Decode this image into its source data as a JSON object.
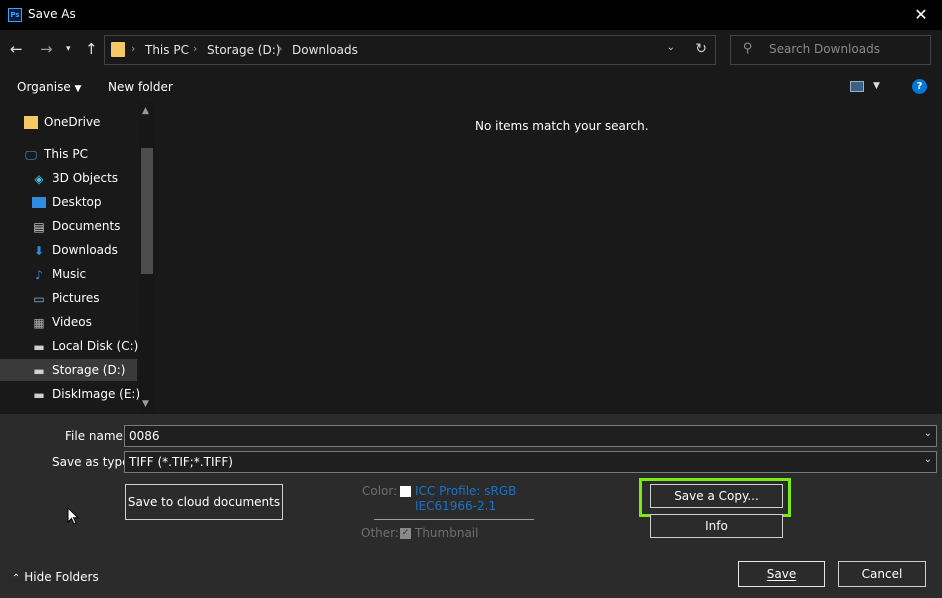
{
  "window": {
    "title": "Save As",
    "app_icon_text": "Ps"
  },
  "address": {
    "crumbs": [
      "This PC",
      "Storage (D:)",
      "Downloads"
    ]
  },
  "search": {
    "placeholder": "Search Downloads"
  },
  "toolbar": {
    "organise": "Organise",
    "new_folder": "New folder"
  },
  "sidebar": {
    "items": [
      {
        "label": "OneDrive",
        "icon": "onedrive-folder-icon"
      },
      {
        "label": "This PC",
        "icon": "computer-icon"
      },
      {
        "label": "3D Objects",
        "icon": "3d-objects-icon"
      },
      {
        "label": "Desktop",
        "icon": "desktop-icon"
      },
      {
        "label": "Documents",
        "icon": "documents-icon"
      },
      {
        "label": "Downloads",
        "icon": "download-arrow-icon"
      },
      {
        "label": "Music",
        "icon": "music-note-icon"
      },
      {
        "label": "Pictures",
        "icon": "pictures-icon"
      },
      {
        "label": "Videos",
        "icon": "videos-icon"
      },
      {
        "label": "Local Disk (C:)",
        "icon": "drive-icon"
      },
      {
        "label": "Storage (D:)",
        "icon": "drive-icon"
      },
      {
        "label": "DiskImage (E:)",
        "icon": "drive-icon"
      }
    ]
  },
  "content": {
    "empty_message": "No items match your search."
  },
  "form": {
    "file_name_label": "File name:",
    "file_name_value": "0086",
    "save_type_label": "Save as type:",
    "save_type_value": "TIFF (*.TIF;*.TIFF)"
  },
  "options": {
    "cloud_button": "Save to cloud documents",
    "color_label": "Color:",
    "icc_profile_line1": "ICC Profile:  sRGB",
    "icc_profile_line2": "IEC61966-2.1",
    "other_label": "Other:",
    "thumbnail_label": "Thumbnail",
    "save_copy_button": "Save a Copy...",
    "info_button": "Info"
  },
  "footer": {
    "hide_folders": "Hide Folders",
    "save_button": "Save",
    "cancel_button": "Cancel"
  },
  "colors": {
    "highlight": "#7bea13",
    "accent": "#0078d7"
  }
}
